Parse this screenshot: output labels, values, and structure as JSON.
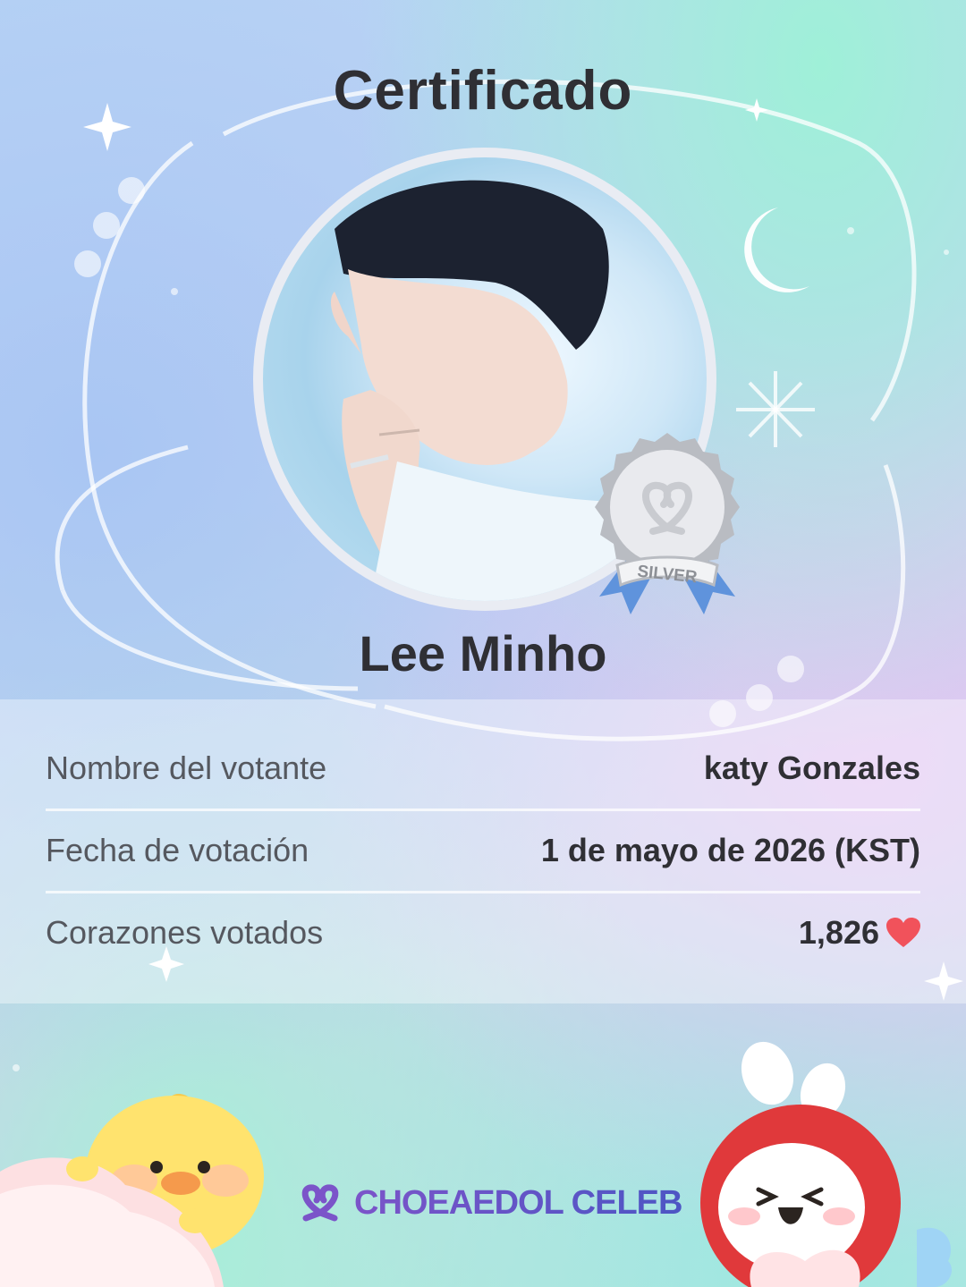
{
  "title": "Certificado",
  "idol": {
    "name": "Lee Minho",
    "photo_icon": "idol-portrait"
  },
  "badge": {
    "tier": "SILVER",
    "icon": "silver-medal-icon"
  },
  "details": [
    {
      "label": "Nombre del votante",
      "value": "katy  Gonzales"
    },
    {
      "label": "Fecha de votación",
      "value": "1 de mayo de 2026 (KST)"
    },
    {
      "label": "Corazones votados",
      "value": "1,826",
      "icon": "heart-icon"
    }
  ],
  "brand": {
    "name": "CHOEAEDOL CELEB",
    "icon": "choeaedol-heart-logo-icon"
  },
  "colors": {
    "heart": "#f1525b",
    "text": "#2f2f34",
    "label": "#55585f",
    "brand": "#6a55c8"
  }
}
